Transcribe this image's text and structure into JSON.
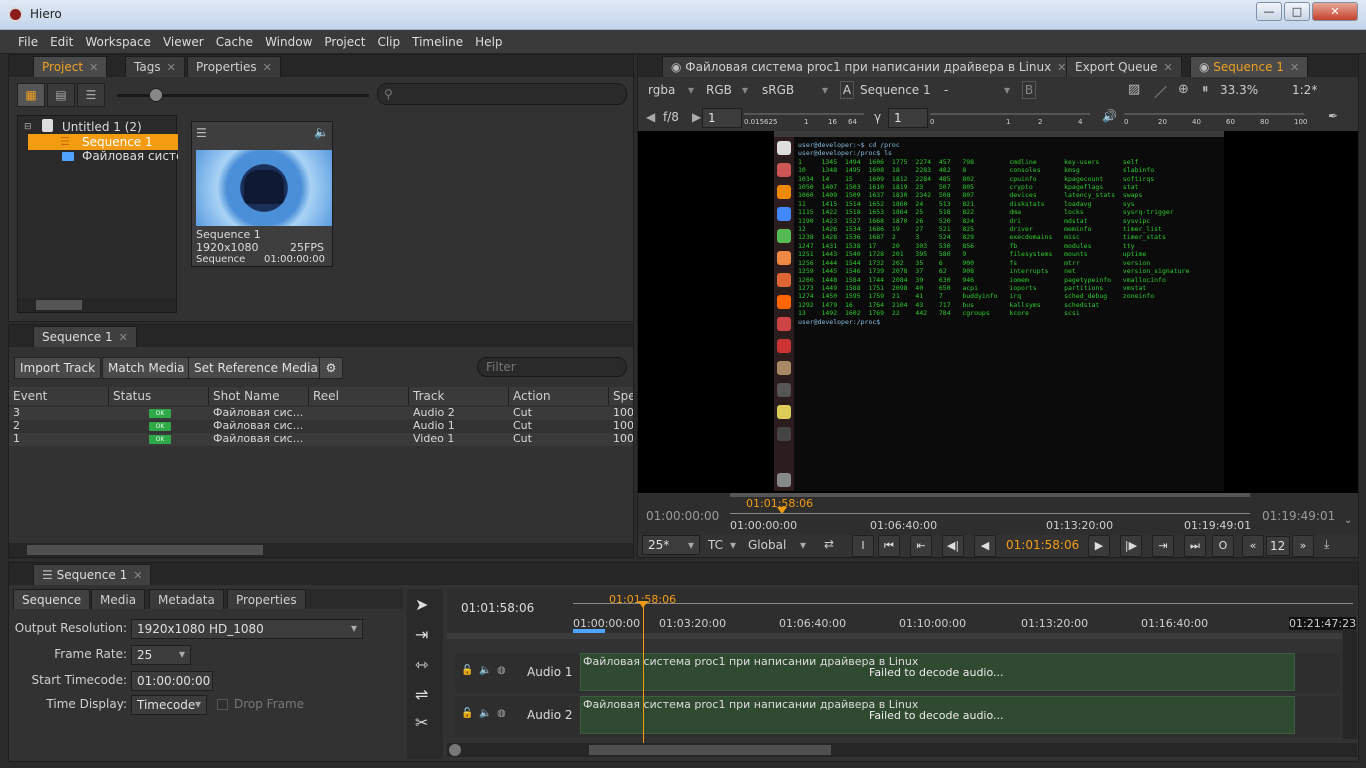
{
  "window": {
    "title": "Hiero",
    "minimize": "—",
    "maximize": "□",
    "close": "✕"
  },
  "menu": [
    "File",
    "Edit",
    "Workspace",
    "Viewer",
    "Cache",
    "Window",
    "Project",
    "Clip",
    "Timeline",
    "Help"
  ],
  "project_panel": {
    "tabs": [
      "Project",
      "Tags",
      "Properties"
    ],
    "tree": {
      "root": "Untitled 1 (2)",
      "items": [
        "Sequence 1",
        "Файловая систе"
      ]
    },
    "thumbnail": {
      "name": "Sequence 1",
      "resolution": "1920x1080",
      "fps": "25FPS",
      "type": "Sequence",
      "timecode": "01:00:00:00"
    }
  },
  "spreadsheet": {
    "tab": "Sequence 1",
    "buttons": {
      "import": "Import Track",
      "match": "Match Media",
      "ref": "Set Reference Media"
    },
    "filter_placeholder": "Filter",
    "columns": [
      "Event",
      "Status",
      "Shot Name",
      "Reel",
      "Track",
      "Action",
      "Spe"
    ],
    "rows": [
      {
        "event": "3",
        "status": "OK",
        "shot": "Файловая сис...",
        "reel": "",
        "track": "Audio 2",
        "action": "Cut",
        "speed": "100"
      },
      {
        "event": "2",
        "status": "OK",
        "shot": "Файловая сис...",
        "reel": "",
        "track": "Audio 1",
        "action": "Cut",
        "speed": "100"
      },
      {
        "event": "1",
        "status": "OK",
        "shot": "Файловая сис...",
        "reel": "",
        "track": "Video 1",
        "action": "Cut",
        "speed": "100"
      }
    ]
  },
  "viewer": {
    "tabs": [
      "Файловая система proc1 при написании драйвера в Linux",
      "Export Queue",
      "Sequence 1"
    ],
    "channels": "rgba",
    "color": "RGB",
    "lut": "sRGB",
    "a_label": "A",
    "a_value": "Sequence 1",
    "dash": "-",
    "b_label": "B",
    "zoom": "33.3%",
    "ratio": "1:2*",
    "fstop": "f/8",
    "gain": "1",
    "gamma_label": "γ",
    "gamma": "1",
    "gain_ticks": [
      "0.015625",
      "1",
      "16",
      "64"
    ],
    "gamma_ticks": [
      "0",
      "1",
      "2",
      "4"
    ],
    "vol_ticks": [
      "0",
      "20",
      "40",
      "60",
      "80",
      "100"
    ],
    "tc_start": "01:00:00:00",
    "tc_end": "01:19:49:01",
    "tc_current": "01:01:58:06",
    "ruler": [
      "01:00:00:00",
      "01:06:40:00",
      "01:13:20:00",
      "01:19:49:01"
    ],
    "fps": "25*",
    "tc_mode": "TC",
    "global": "Global",
    "step": "12",
    "in_label": "I",
    "out_label": "O"
  },
  "terminal": {
    "prompt1": "user@developer:~$ cd /proc",
    "prompt2": "user@developer:/proc$ ls",
    "prompt3": "user@developer:/proc$",
    "lines": [
      "1     1345  1494  1606  1775  2274  457   798         cmdline       key-users      self",
      "10    1348  1495  1608  18    2283  482   8           consoles      kmsg           slabinfo",
      "1034  14    15    1609  1812  2284  485   802         cpuinfo       kpagecount     softirqs",
      "1050  1407  1503  1610  1819  23    507   805         crypto        kpageflags     stat",
      "1060  1409  1509  1637  1830  2342  508   807         devices       latency_stats  swaps",
      "11    1415  1514  1652  1860  24    513   821         diskstats     loadavg        sys",
      "1115  1422  1518  1653  1864  25    518   822         dma           locks          sysrq-trigger",
      "1190  1423  1527  1668  1870  26    520   824         dri           mdstat         sysvipc",
      "12    1426  1534  1686  19    27    521   825         driver        meminfo        timer_list",
      "1238  1428  1536  1687  2     3     524   829         execdomains   misc           timer_stats",
      "1247  1431  1538  17    20    303   530   856         fb            modules        tty",
      "1251  1443  1540  1728  201   395   580   9           filesystems   mounts         uptime",
      "1256  1444  1544  1732  202   35    6     900         fs            mtrr           version",
      "1259  1445  1546  1739  2078  37    62    908         interrupts    net            version_signature",
      "1260  1448  1584  1744  2084  39    630   946         iomem         pagetypeinfo   vmallocinfo",
      "1273  1449  1588  1751  2098  40    650   acpi        ioports       partitions     vmstat",
      "1274  1450  1595  1759  21    41    7     buddyinfo   irq           sched_debug    zoneinfo",
      "1292  1479  16    1764  2104  43    717   bus         kallsyms      schedstat",
      "13    1492  1602  1769  22    442   784   cgroups     kcore         scsi"
    ]
  },
  "timeline": {
    "tab": "Sequence 1",
    "prop_tabs": [
      "Sequence",
      "Media",
      "Metadata",
      "Properties"
    ],
    "output_resolution_label": "Output Resolution:",
    "output_resolution": "1920x1080 HD_1080",
    "frame_rate_label": "Frame Rate:",
    "frame_rate": "25",
    "start_tc_label": "Start Timecode:",
    "start_tc": "01:00:00:00",
    "time_display_label": "Time Display:",
    "time_display": "Timecode",
    "drop_frame": "Drop Frame",
    "current_tc": "01:01:58:06",
    "playhead_tc": "01:01:58:06",
    "ruler": [
      "01:00:00:00",
      "01:03:20:00",
      "01:06:40:00",
      "01:10:00:00",
      "01:13:20:00",
      "01:16:40:00",
      "01:21:47:23"
    ],
    "tracks": [
      {
        "name": "Audio 1",
        "clip": "Файловая система proc1 при написании драйвера в Linux",
        "msg": "Failed to decode audio..."
      },
      {
        "name": "Audio 2",
        "clip": "Файловая система proc1 при написании драйвера в Linux",
        "msg": "Failed to decode audio..."
      }
    ]
  }
}
